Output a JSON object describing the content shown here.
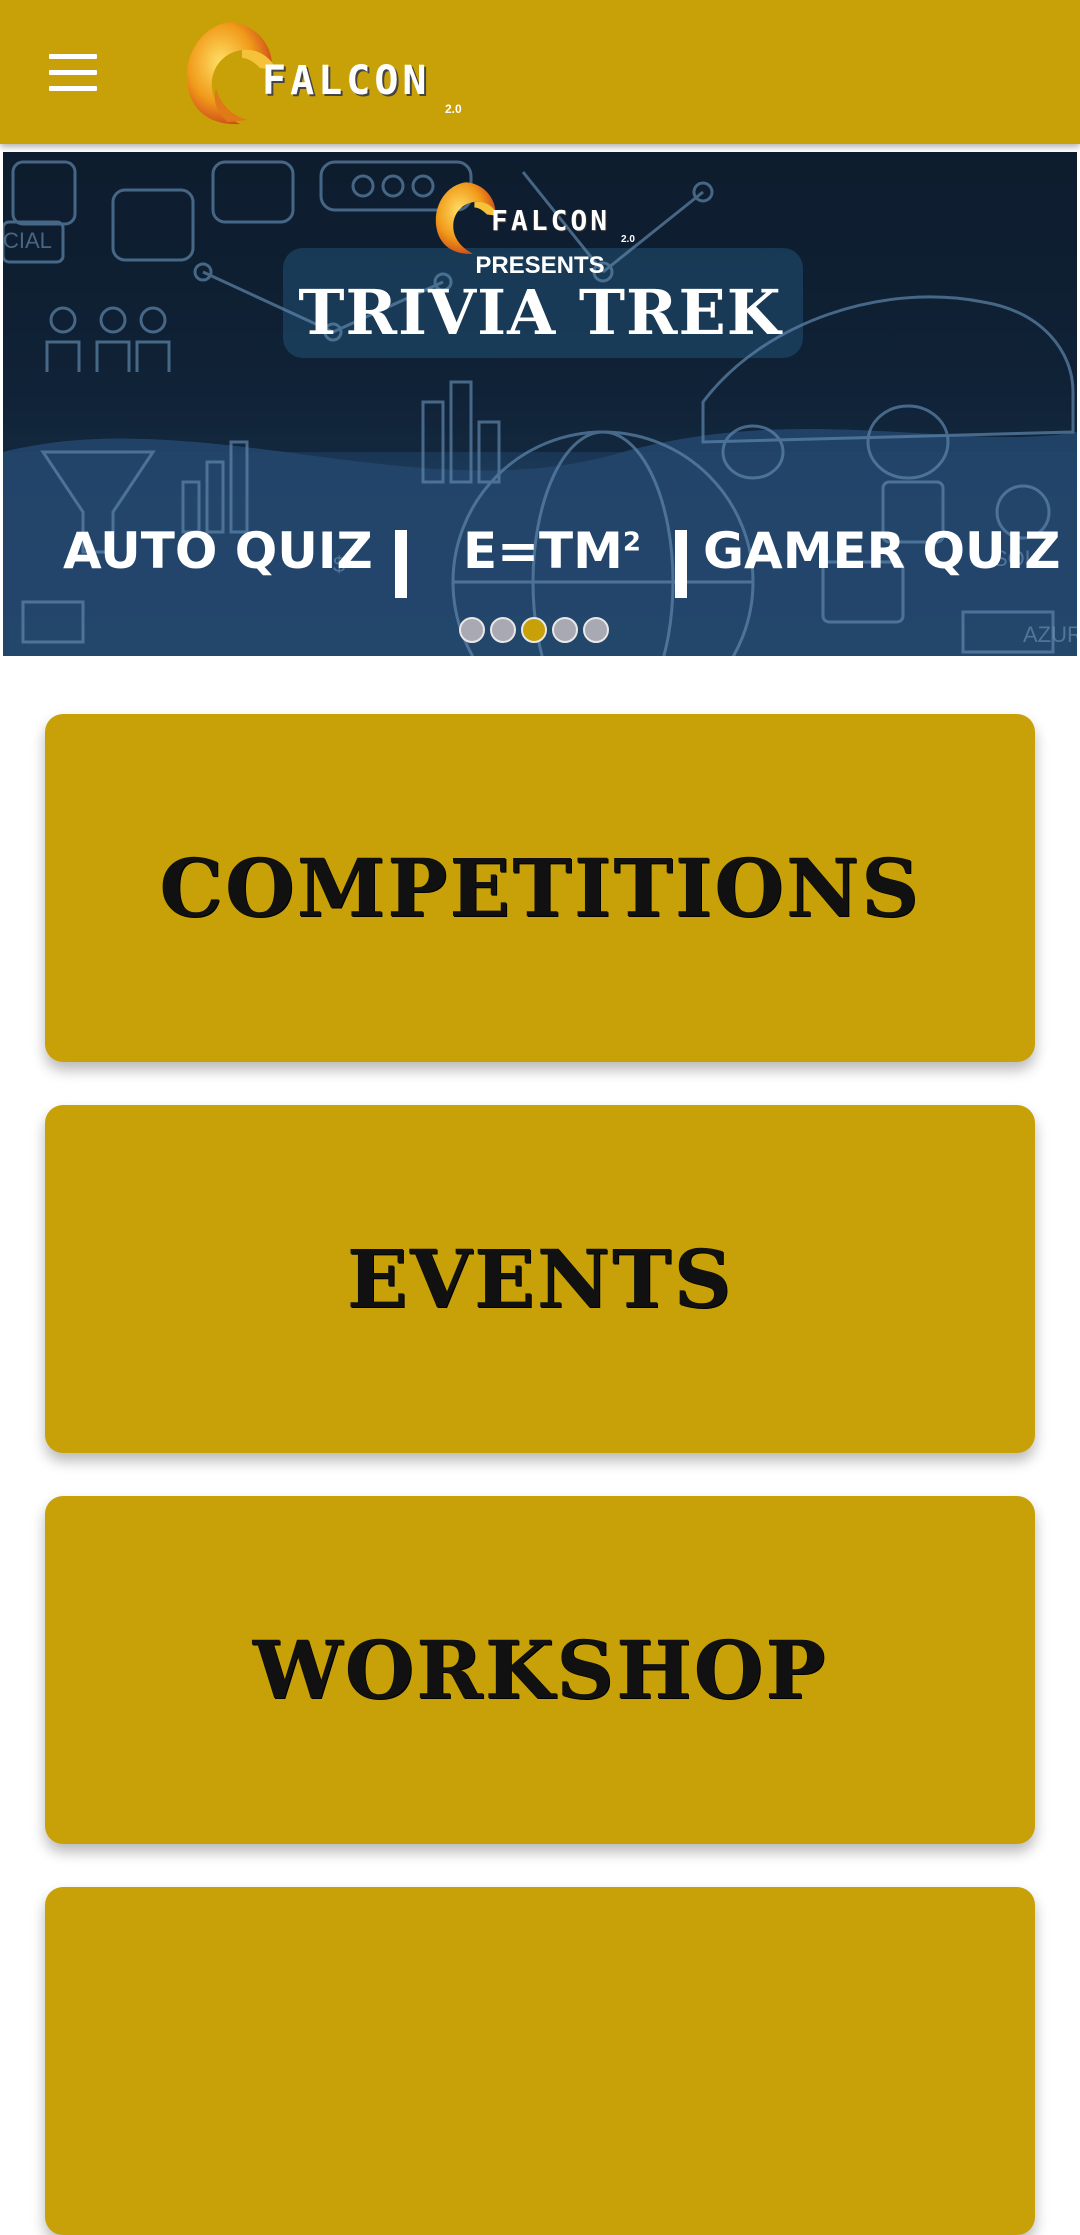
{
  "app": {
    "logo_text": "FALCON",
    "logo_version": "2.0",
    "menu_icon": "hamburger-menu-icon",
    "brand_color": "#c8a108"
  },
  "banner": {
    "logo_text": "FALCON",
    "logo_version": "2.0",
    "presents": "PRESENTS",
    "title": "TRIVIA TREK",
    "items": [
      "AUTO QUIZ",
      "E=TM",
      "GAMER QUIZ"
    ],
    "superscript": "2",
    "slide_count": 5,
    "active_slide": 3
  },
  "cards": [
    {
      "label": "COMPETITIONS"
    },
    {
      "label": "EVENTS"
    },
    {
      "label": "WORKSHOP"
    },
    {
      "label": ""
    }
  ]
}
